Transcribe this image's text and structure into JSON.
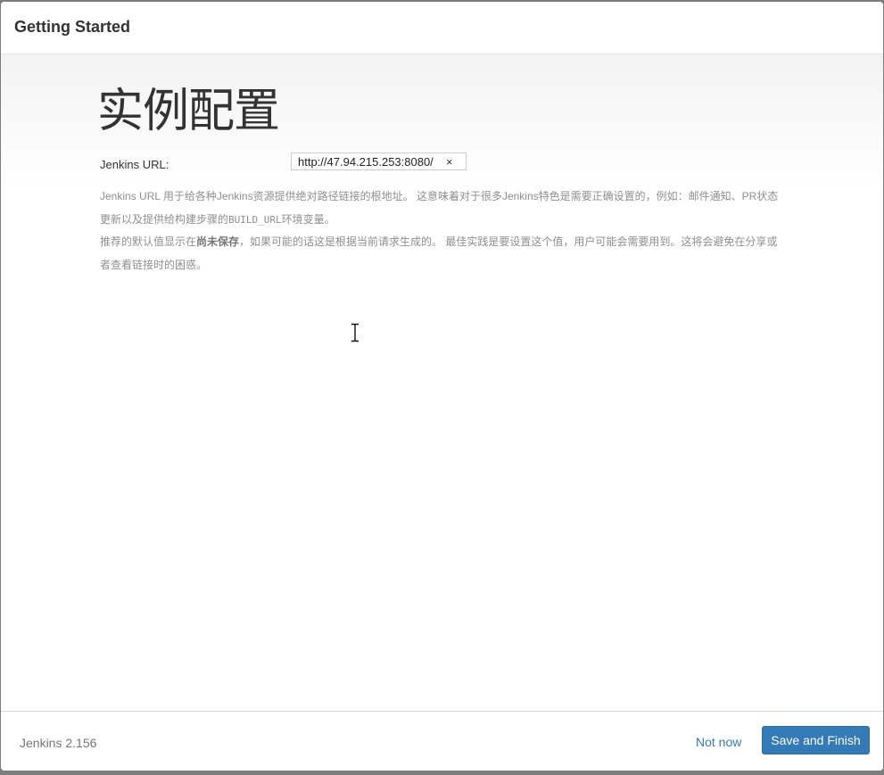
{
  "header": {
    "title": "Getting Started"
  },
  "main": {
    "heading": "实例配置",
    "url_label": "Jenkins URL:",
    "url_value": "http://47.94.215.253:8080/",
    "clear_icon": "×",
    "help_1a": "Jenkins URL 用于给各种Jenkins资源提供绝对路径链接的根地址。 这意味着对于很多Jenkins特色是需要正确设置的，例如：邮件通知、PR状态更新以及提供给构建步骤的",
    "help_1_code": "BUILD_URL",
    "help_1b": "环境变量。",
    "help_2a": "推荐的默认值显示在",
    "help_2_strong": "尚未保存",
    "help_2b": "，如果可能的话这是根据当前请求生成的。 最佳实践是要设置这个值，用户可能会需要用到。这将会避免在分享或者查看链接时的困惑。"
  },
  "cursor": {
    "icon": "text-cursor-icon"
  },
  "footer": {
    "version": "Jenkins 2.156",
    "not_now_label": "Not now",
    "save_finish_label": "Save and Finish"
  },
  "colors": {
    "primary": "#337ab7",
    "link": "#337ab7",
    "help_text": "#8f8f8f"
  }
}
